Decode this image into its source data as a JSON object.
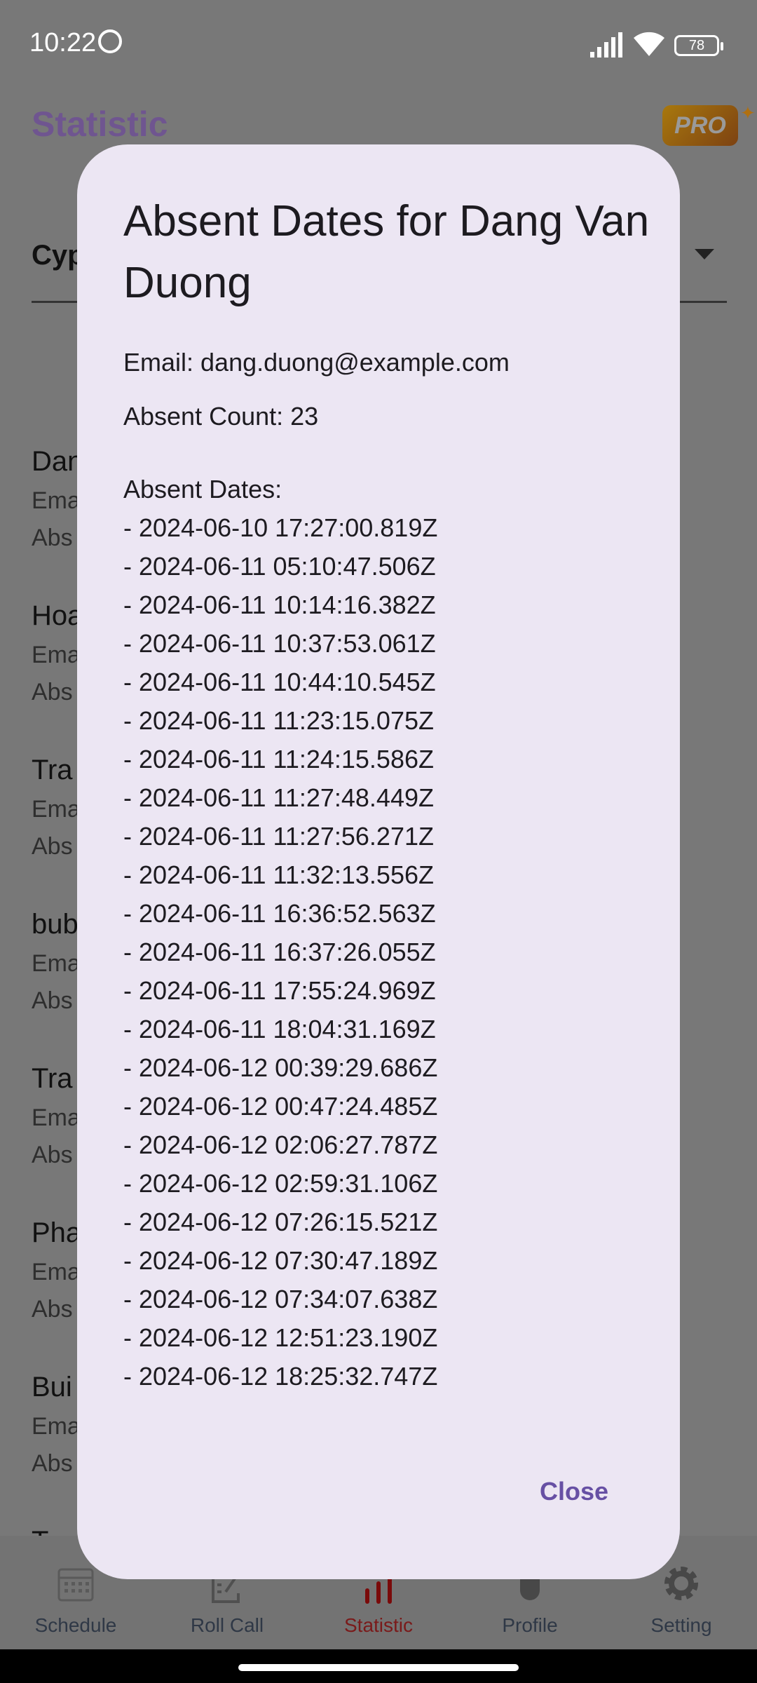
{
  "status_bar": {
    "time": "10:22",
    "battery": "78"
  },
  "app": {
    "title": "Statistic",
    "pro_badge": "PRO"
  },
  "dropdown": {
    "value": "Cyp"
  },
  "background_list": [
    {
      "name": "Dan",
      "email": "Ema",
      "absent": "Abs"
    },
    {
      "name": "Hoa",
      "email": "Ema",
      "absent": "Abs"
    },
    {
      "name": "Tra",
      "email": "Ema",
      "absent": "Abs"
    },
    {
      "name": "bub",
      "email": "Ema",
      "absent": "Abs"
    },
    {
      "name": "Tra",
      "email": "Ema",
      "absent": "Abs"
    },
    {
      "name": "Pha",
      "email": "Ema",
      "absent": "Abs"
    },
    {
      "name": "Bui",
      "email": "Ema",
      "absent": "Abs"
    },
    {
      "name": "T"
    }
  ],
  "bottom_nav": {
    "items": [
      {
        "label": "Schedule",
        "icon": "calendar-icon"
      },
      {
        "label": "Roll Call",
        "icon": "edit-note-icon"
      },
      {
        "label": "Statistic",
        "icon": "bar-chart-icon",
        "active": true
      },
      {
        "label": "Profile",
        "icon": "person-icon"
      },
      {
        "label": "Setting",
        "icon": "gear-icon"
      }
    ],
    "active_color": "#8b0000"
  },
  "dialog": {
    "title": "Absent Dates for Dang Van Duong",
    "email": "Email: dang.duong@example.com",
    "count": "Absent Count: 23",
    "dates_heading": "Absent Dates:",
    "dates": [
      "- 2024-06-10 17:27:00.819Z",
      "- 2024-06-11 05:10:47.506Z",
      "- 2024-06-11 10:14:16.382Z",
      "- 2024-06-11 10:37:53.061Z",
      "- 2024-06-11 10:44:10.545Z",
      "- 2024-06-11 11:23:15.075Z",
      "- 2024-06-11 11:24:15.586Z",
      "- 2024-06-11 11:27:48.449Z",
      "- 2024-06-11 11:27:56.271Z",
      "- 2024-06-11 11:32:13.556Z",
      "- 2024-06-11 16:36:52.563Z",
      "- 2024-06-11 16:37:26.055Z",
      "- 2024-06-11 17:55:24.969Z",
      "- 2024-06-11 18:04:31.169Z",
      "- 2024-06-12 00:39:29.686Z",
      "- 2024-06-12 00:47:24.485Z",
      "- 2024-06-12 02:06:27.787Z",
      "- 2024-06-12 02:59:31.106Z",
      "- 2024-06-12 07:26:15.521Z",
      "- 2024-06-12 07:30:47.189Z",
      "- 2024-06-12 07:34:07.638Z",
      "- 2024-06-12 12:51:23.190Z",
      "- 2024-06-12 18:25:32.747Z"
    ],
    "close_label": "Close",
    "accent": "#6750a4"
  }
}
